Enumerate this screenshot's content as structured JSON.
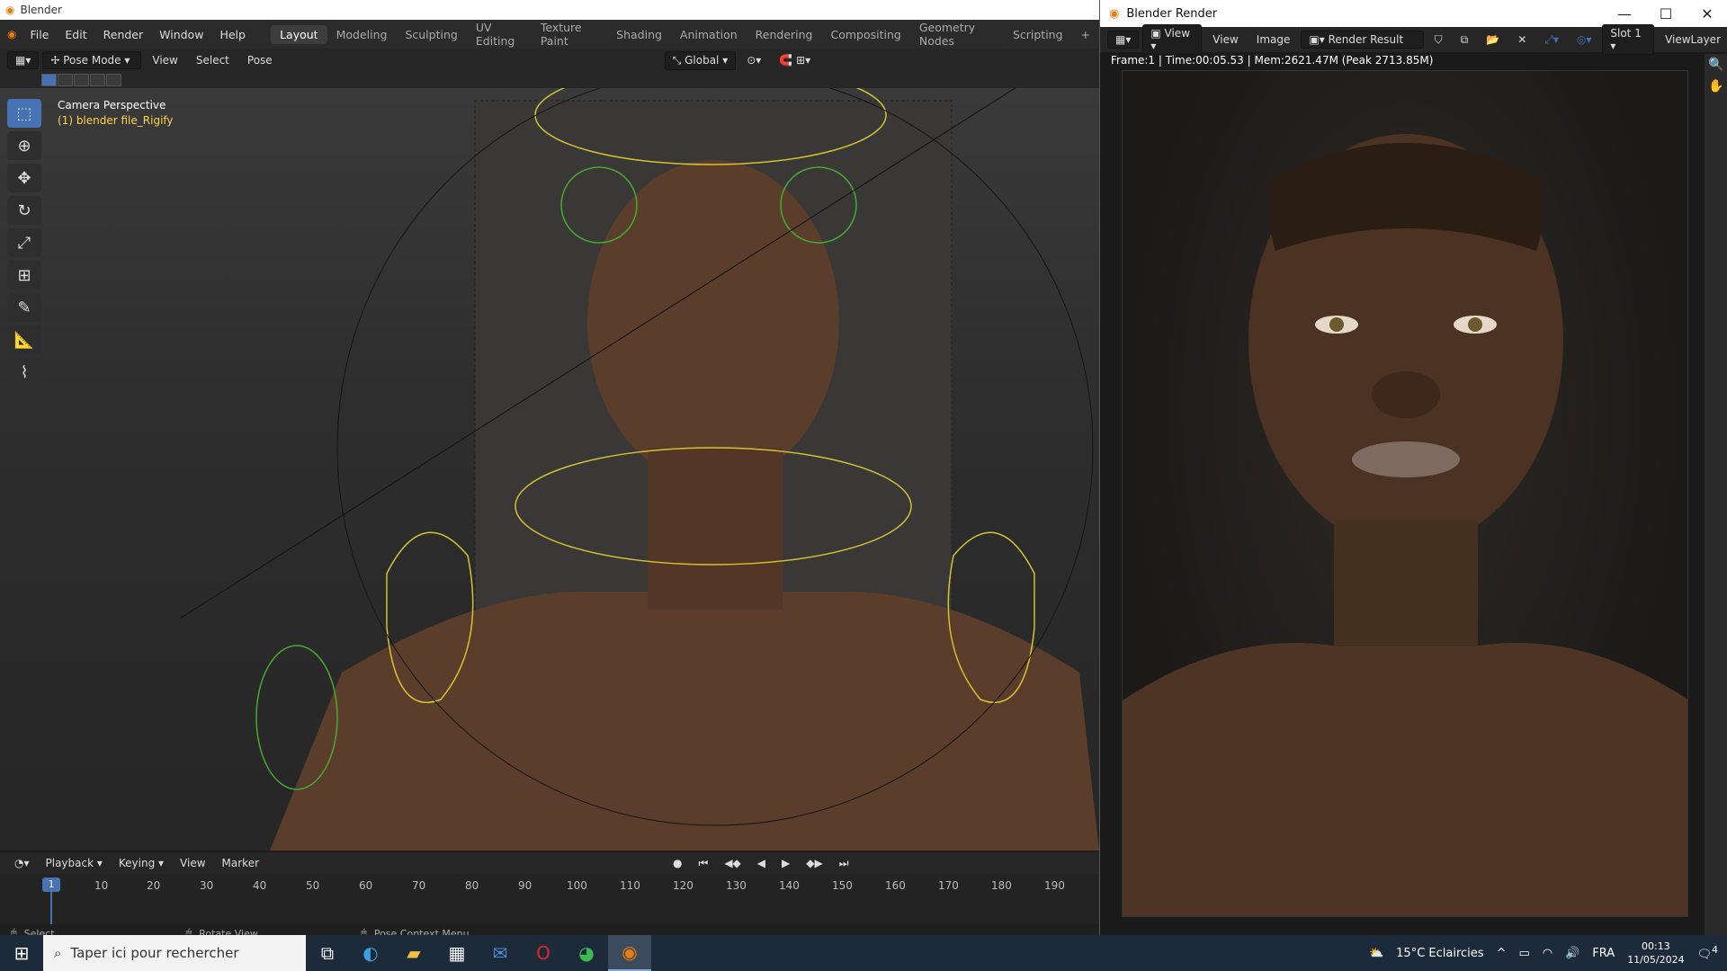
{
  "app": {
    "title": "Blender"
  },
  "menu": [
    "File",
    "Edit",
    "Render",
    "Window",
    "Help"
  ],
  "workspaces": [
    "Layout",
    "Modeling",
    "Sculpting",
    "UV Editing",
    "Texture Paint",
    "Shading",
    "Animation",
    "Rendering",
    "Compositing",
    "Geometry Nodes",
    "Scripting"
  ],
  "header": {
    "mode": "Pose Mode",
    "view": "View",
    "select": "Select",
    "pose": "Pose",
    "orientation": "Global"
  },
  "viewport": {
    "camera_label": "Camera Perspective",
    "object_label": "(1) blender file_Rigify"
  },
  "timeline": {
    "playback": "Playback",
    "keying": "Keying",
    "view": "View",
    "marker": "Marker",
    "current_frame": "1",
    "frames": [
      "10",
      "20",
      "30",
      "40",
      "50",
      "60",
      "70",
      "80",
      "90",
      "100",
      "110",
      "120",
      "130",
      "140",
      "150",
      "160",
      "170",
      "180",
      "190"
    ]
  },
  "status": {
    "select": "Select",
    "rotate": "Rotate View",
    "context": "Pose Context Menu"
  },
  "render": {
    "title": "Blender Render",
    "view": "View",
    "view2": "View",
    "image": "Image",
    "result": "Render Result",
    "slot": "Slot 1",
    "layer": "ViewLayer",
    "info": "Frame:1 | Time:00:05.53 | Mem:2621.47M (Peak 2713.85M)"
  },
  "taskbar": {
    "search_placeholder": "Taper ici pour rechercher",
    "weather": "15°C  Eclaircies",
    "lang": "FRA",
    "time": "00:13",
    "date": "11/05/2024",
    "notif_count": "4"
  }
}
